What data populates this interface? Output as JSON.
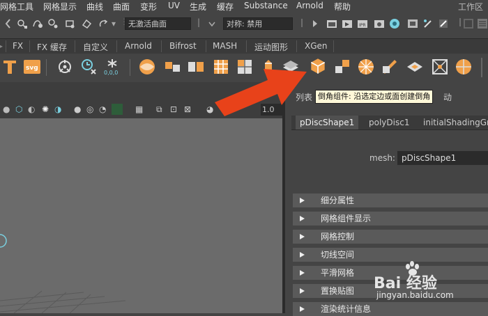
{
  "menubar": {
    "items": [
      "网格工具",
      "网格显示",
      "曲线",
      "曲面",
      "变形",
      "UV",
      "生成",
      "缓存",
      "Substance",
      "Arnold",
      "帮助"
    ],
    "workspace_label": "工作区"
  },
  "statusline": {
    "live_surface": "无激活曲面",
    "symmetry": "对称: 禁用"
  },
  "shelf_tabs": [
    "FX",
    "FX 缓存",
    "自定义",
    "Arnold",
    "Bifrost",
    "MASH",
    "运动图形",
    "XGen"
  ],
  "shelf": {
    "svg_label": "svg",
    "num_label": "0,0,0"
  },
  "attribute_editor": {
    "header_left": "列表",
    "header_right": "动",
    "node_tabs": [
      "pDiscShape1",
      "polyDisc1",
      "initialShadingGr"
    ],
    "active_tab": "pDiscShape1",
    "mesh_label": "mesh:",
    "mesh_value": "pDiscShape1",
    "sections": [
      "细分属性",
      "网格组件显示",
      "网格控制",
      "切线空间",
      "平滑网格",
      "置换贴图",
      "渲染统计信息"
    ]
  },
  "viewport": {
    "frame_value": "1.0"
  },
  "tooltip": "倒角组件: 沿选定边或面创建倒角",
  "watermark": {
    "brand": "Bai 经验",
    "url": "jingyan.baidu.com"
  },
  "colors": {
    "accent_orange": "#f0a04a",
    "arrow_red": "#e8421a",
    "ui_dark": "#444444"
  }
}
